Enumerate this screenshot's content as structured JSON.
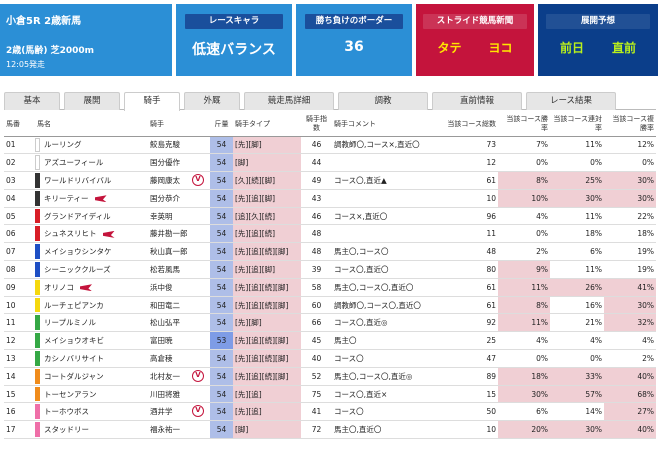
{
  "race": {
    "title": "小倉5R 2歳新馬",
    "course": "2歳(馬齢) 芝2000m",
    "time": "12:05発走"
  },
  "race_char": {
    "label": "レースキャラ",
    "value": "低速バランス"
  },
  "border": {
    "label": "勝ち負けのボーダー",
    "value": "36"
  },
  "stride": {
    "label": "ストライド競馬新聞",
    "tate": "タテ",
    "yoko": "ヨコ"
  },
  "forecast": {
    "label": "展開予想",
    "zenjitsu": "前日",
    "chokuzen": "直前"
  },
  "tabs": [
    "基本",
    "展開",
    "騎手",
    "外厩",
    "競走馬詳細",
    "調教",
    "直前情報",
    "レース結果"
  ],
  "active_tab": "騎手",
  "headers": [
    "馬番",
    "馬名",
    "騎手",
    "斤量",
    "騎手タイプ",
    "騎手指数",
    "騎手コメント",
    "当該コース総数",
    "当該コース勝率",
    "当該コース連対率",
    "当該コース複勝率"
  ],
  "rows": [
    {
      "no": "01",
      "name": "ルーリング",
      "color": "#ffffff",
      "jockey": "鮫島克駿",
      "w": "54",
      "type": "[先][脚]",
      "idx": "46",
      "comment": "調教師〇,コース×,直近〇",
      "n": "73",
      "win": "7%",
      "ren": "11%",
      "fuku": "12%"
    },
    {
      "no": "02",
      "name": "アズユーフィール",
      "color": "#ffffff",
      "jockey": "国分優作",
      "w": "54",
      "type": "[脚]",
      "idx": "44",
      "comment": "",
      "n": "12",
      "win": "0%",
      "ren": "0%",
      "fuku": "0%"
    },
    {
      "no": "03",
      "name": "ワールドリバイバル",
      "color": "#333333",
      "jockey": "藤岡康太",
      "w": "54",
      "type": "[久][続][脚]",
      "idx": "49",
      "comment": "コース〇,直近▲",
      "n": "61",
      "win": "8%",
      "ren": "25%",
      "fuku": "30%",
      "mark": "V"
    },
    {
      "no": "04",
      "name": "キリーティー",
      "color": "#333333",
      "jockey": "国分恭介",
      "w": "54",
      "type": "[先][追][脚]",
      "idx": "43",
      "comment": "",
      "n": "10",
      "win": "10%",
      "ren": "30%",
      "fuku": "30%",
      "flag": true
    },
    {
      "no": "05",
      "name": "グランドアイディル",
      "color": "#d81e27",
      "jockey": "幸英明",
      "w": "54",
      "type": "[追][久][続]",
      "idx": "46",
      "comment": "コース×,直近〇",
      "n": "96",
      "win": "4%",
      "ren": "11%",
      "fuku": "22%"
    },
    {
      "no": "06",
      "name": "シュネスリヒト",
      "color": "#d81e27",
      "jockey": "藤井勘一郎",
      "w": "54",
      "type": "[先][追][続]",
      "idx": "48",
      "comment": "",
      "n": "11",
      "win": "0%",
      "ren": "18%",
      "fuku": "18%",
      "flag": true
    },
    {
      "no": "07",
      "name": "メイショウシンタケ",
      "color": "#1e4fc4",
      "jockey": "秋山真一郎",
      "w": "54",
      "type": "[先][追][続][脚]",
      "idx": "48",
      "comment": "馬主〇,コース〇",
      "n": "48",
      "win": "2%",
      "ren": "6%",
      "fuku": "19%"
    },
    {
      "no": "08",
      "name": "シーニッククルーズ",
      "color": "#1e4fc4",
      "jockey": "松若風馬",
      "w": "54",
      "type": "[先][追][脚]",
      "idx": "39",
      "comment": "コース〇,直近〇",
      "n": "80",
      "win": "9%",
      "ren": "11%",
      "fuku": "19%"
    },
    {
      "no": "09",
      "name": "オリノコ",
      "color": "#f5d80e",
      "jockey": "浜中俊",
      "w": "54",
      "type": "[先][追][続][脚]",
      "idx": "58",
      "comment": "馬主〇,コース〇,直近〇",
      "n": "61",
      "win": "11%",
      "ren": "26%",
      "fuku": "41%",
      "flag": true
    },
    {
      "no": "10",
      "name": "ルーチェピアンカ",
      "color": "#f5d80e",
      "jockey": "和田竜二",
      "w": "54",
      "type": "[先][追][続][脚]",
      "idx": "60",
      "comment": "調教師〇,コース〇,直近〇",
      "n": "61",
      "win": "8%",
      "ren": "16%",
      "fuku": "30%"
    },
    {
      "no": "11",
      "name": "リープルミノル",
      "color": "#35a845",
      "jockey": "松山弘平",
      "w": "54",
      "type": "[先][脚]",
      "idx": "66",
      "comment": "コース〇,直近◎",
      "n": "92",
      "win": "11%",
      "ren": "21%",
      "fuku": "32%"
    },
    {
      "no": "12",
      "name": "メイショウオキビ",
      "color": "#35a845",
      "jockey": "富田暁",
      "w": "53",
      "type": "[先][追][続][脚]",
      "idx": "45",
      "comment": "馬主〇",
      "n": "25",
      "win": "4%",
      "ren": "4%",
      "fuku": "4%",
      "lo": true
    },
    {
      "no": "13",
      "name": "カシノバリサイト",
      "color": "#35a845",
      "jockey": "高倉稜",
      "w": "54",
      "type": "[先][追][続][脚]",
      "idx": "40",
      "comment": "コース〇",
      "n": "47",
      "win": "0%",
      "ren": "0%",
      "fuku": "2%"
    },
    {
      "no": "14",
      "name": "コートダルジャン",
      "color": "#f08c1c",
      "jockey": "北村友一",
      "w": "54",
      "type": "[先][追][続][脚]",
      "idx": "52",
      "comment": "馬主〇,コース〇,直近◎",
      "n": "89",
      "win": "18%",
      "ren": "33%",
      "fuku": "40%",
      "mark": "V"
    },
    {
      "no": "15",
      "name": "トーセンアラン",
      "color": "#f08c1c",
      "jockey": "川田将雅",
      "w": "54",
      "type": "[先][追]",
      "idx": "75",
      "comment": "コース〇,直近×",
      "n": "15",
      "win": "30%",
      "ren": "57%",
      "fuku": "68%"
    },
    {
      "no": "16",
      "name": "トーホウボス",
      "color": "#ef6fa8",
      "jockey": "酒井学",
      "w": "54",
      "type": "[先][追]",
      "idx": "41",
      "comment": "コース〇",
      "n": "50",
      "win": "6%",
      "ren": "14%",
      "fuku": "27%",
      "mark": "V"
    },
    {
      "no": "17",
      "name": "スタッドリー",
      "color": "#ef6fa8",
      "jockey": "福永祐一",
      "w": "54",
      "type": "[脚]",
      "idx": "72",
      "comment": "馬主〇,直近〇",
      "n": "10",
      "win": "20%",
      "ren": "30%",
      "fuku": "40%"
    }
  ]
}
